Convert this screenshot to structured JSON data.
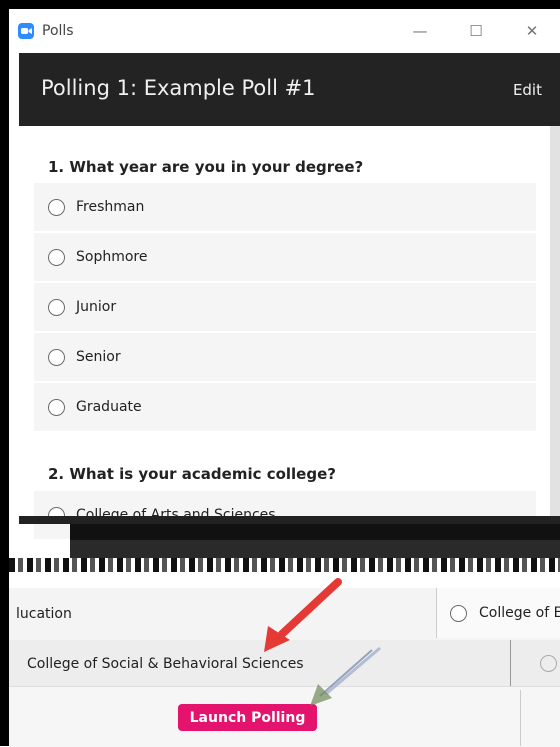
{
  "window": {
    "title": "Polls",
    "minimize_glyph": "—",
    "maximize_glyph": "☐",
    "close_glyph": "✕",
    "app_icon": "zoom-camera-icon",
    "app_icon_color": "#2d8cff"
  },
  "header": {
    "title": "Polling 1: Example Poll #1",
    "edit_label": "Edit",
    "background": "#232323"
  },
  "questions": [
    {
      "label": "1. What year are you in your degree?",
      "options": [
        "Freshman",
        "Sophmore",
        "Junior",
        "Senior",
        "Graduate"
      ]
    },
    {
      "label": "2. What is your academic college?",
      "options": [
        "College of Arts and Sciences"
      ]
    }
  ],
  "fragments": {
    "education_left": "lucation",
    "education_right": "College of Ed",
    "social_sciences": "College of Social & Behavioral Sciences"
  },
  "footer": {
    "launch_label": "Launch Polling",
    "launch_color": "#e4136e"
  },
  "annotation": {
    "arrow_color": "#e53935",
    "arrow_icon": "red-arrow-icon"
  }
}
